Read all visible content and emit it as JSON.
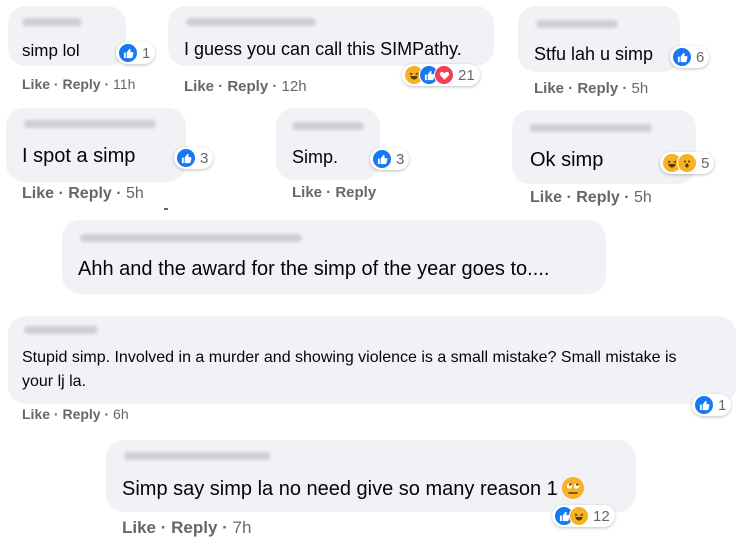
{
  "comments": [
    {
      "text": "simp lol",
      "meta_actions": "Like · Reply ·",
      "time": "11h",
      "reaction_count": "1"
    },
    {
      "text": "I guess you can call this SIMPathy.",
      "meta_actions": "Like · Reply ·",
      "time": "12h",
      "reaction_count": "21"
    },
    {
      "text": "Stfu lah u simp",
      "meta_actions": "Like · Reply ·",
      "time": "5h",
      "reaction_count": "6"
    },
    {
      "text": "I spot a simp",
      "meta_actions": "Like · Reply ·",
      "time": "5h",
      "reaction_count": "3"
    },
    {
      "text": "Simp.",
      "meta_actions": "Like · Reply",
      "time": "",
      "reaction_count": "3"
    },
    {
      "text": "Ok simp",
      "meta_actions": "Like · Reply ·",
      "time": "5h",
      "reaction_count": "5"
    },
    {
      "text": "Ahh and the award for the simp of the year goes to...."
    },
    {
      "text": "Stupid simp. Involved in a murder and showing violence is a small mistake? Small mistake is your lj la.",
      "meta_actions": "Like · Reply ·",
      "time": "6h",
      "reaction_count": "1"
    },
    {
      "text": "Simp say simp la no need give so many reason 1",
      "meta_actions": "Like · Reply ·",
      "time": "7h",
      "reaction_count": "12"
    }
  ],
  "icons": {
    "like": "thumbs-up-icon",
    "haha": "laughing-face-icon",
    "love": "heart-icon",
    "wow": "surprised-face-icon",
    "roll_eyes": "eye-roll-emoji-icon"
  },
  "colors": {
    "bubble": "#f0f2f5",
    "meta_text": "#65676b",
    "like_blue": "#1877f2",
    "haha_yellow": "#f7b125",
    "love_red": "#f33e58"
  }
}
